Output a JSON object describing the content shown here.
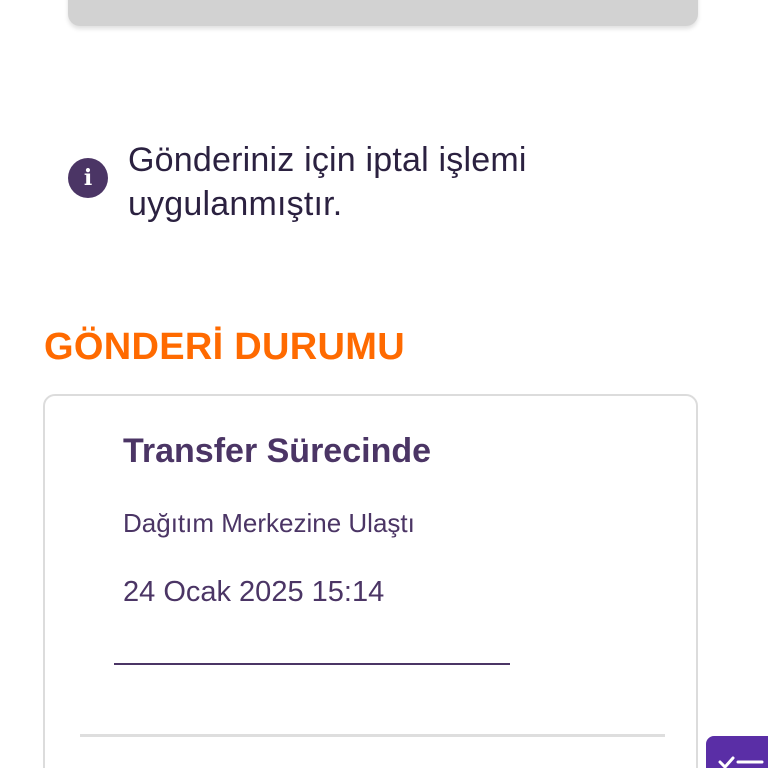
{
  "notice": {
    "icon": "info-icon",
    "text": "Gönderiniz için iptal işlemi uygulanmıştır."
  },
  "section": {
    "title": "GÖNDERİ DURUMU"
  },
  "status": {
    "title": "Transfer Sürecinde",
    "subtitle": "Dağıtım Merkezine Ulaştı",
    "date": "24 Ocak 2025 15:14"
  },
  "fab": {
    "icon": "checklist-icon",
    "color": "#5a2ea6"
  },
  "colors": {
    "accent_orange": "#ff6a00",
    "brand_purple": "#4b3565"
  }
}
